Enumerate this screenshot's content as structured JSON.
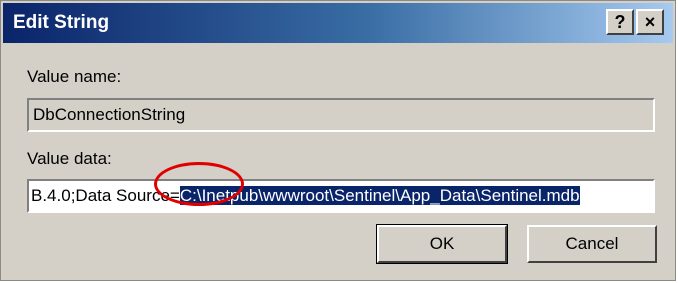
{
  "window": {
    "title": "Edit String",
    "help_glyph": "?",
    "close_glyph": "×",
    "help_icon": "question-mark-icon",
    "close_icon": "close-icon"
  },
  "value_name": {
    "label": "Value name:",
    "value": "DbConnectionString"
  },
  "value_data": {
    "label": "Value data:",
    "value_unselected": "B.4.0;Data Source=",
    "value_selected": "C:\\Inetpub\\wwwroot\\Sentinel\\App_Data\\Sentinel.mdb"
  },
  "buttons": {
    "ok_label": "OK",
    "cancel_label": "Cancel"
  },
  "annotation": {
    "color": "#e00000"
  },
  "colors": {
    "title_bar": "#0a246a",
    "dialog_face": "#d4d0c8",
    "selection": "#0a246a"
  }
}
